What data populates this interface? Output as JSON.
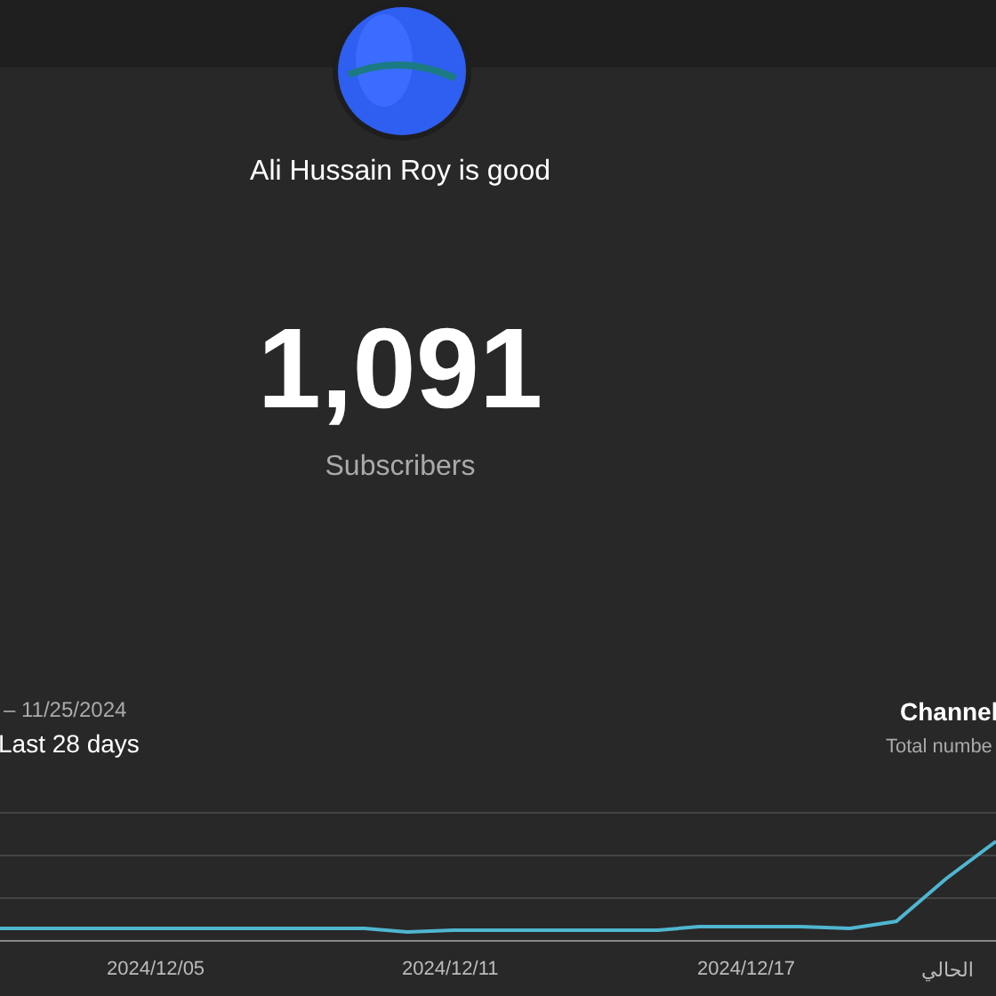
{
  "channel": {
    "name": "Ali Hussain Roy is good"
  },
  "subscribers": {
    "count": "1,091",
    "label": "Subscribers"
  },
  "period": {
    "range": "– 11/25/2024",
    "label": "Last 28 days"
  },
  "metric": {
    "title": "Channel",
    "subtitle": "Total numbe"
  },
  "chart": {
    "x_labels": [
      "2024/12/05",
      "2024/12/11",
      "2024/12/17",
      "الحالي"
    ]
  }
}
